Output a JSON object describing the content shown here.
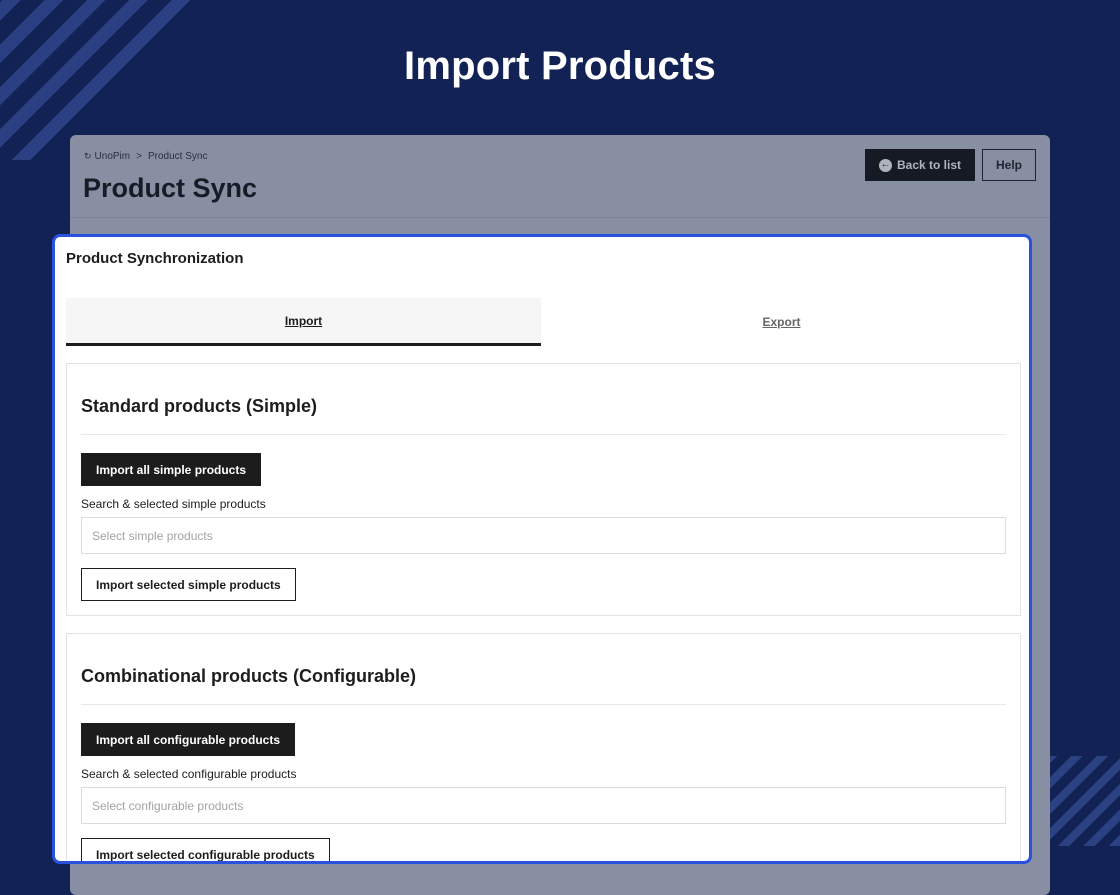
{
  "hero": {
    "title": "Import Products"
  },
  "app": {
    "breadcrumb": {
      "root": "UnoPim",
      "separator": ">",
      "current": "Product Sync"
    },
    "page_title": "Product Sync",
    "back_button": "Back to list",
    "help_button": "Help"
  },
  "card": {
    "title": "Product Synchronization",
    "tabs": [
      {
        "label": "Import",
        "active": true
      },
      {
        "label": "Export",
        "active": false
      }
    ],
    "simple": {
      "title": "Standard products (Simple)",
      "import_all_button": "Import all simple products",
      "search_label": "Search & selected simple products",
      "search_placeholder": "Select simple products",
      "import_selected_button": "Import selected simple products"
    },
    "configurable": {
      "title": "Combinational products (Configurable)",
      "import_all_button": "Import all configurable products",
      "search_label": "Search & selected configurable products",
      "search_placeholder": "Select configurable products",
      "import_selected_button": "Import selected configurable products"
    }
  },
  "colors": {
    "background": "#132254",
    "accent_border": "#2a50e0",
    "dark_button": "#1c1c1c"
  },
  "icons": {
    "breadcrumb_logo": "unopim-logo-icon",
    "back": "arrow-left-circle-icon"
  }
}
